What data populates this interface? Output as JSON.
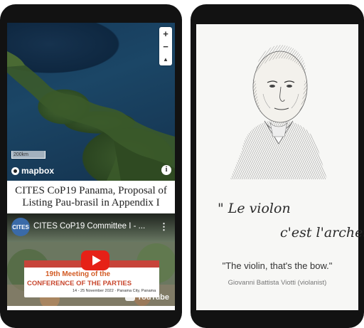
{
  "left_card": {
    "map": {
      "zoom_in_label": "+",
      "zoom_out_label": "−",
      "compass_label": "▲",
      "scale_label": "200km",
      "brand_label": "mapbox",
      "info_label": "i"
    },
    "title_line1": "CITES CoP19 Panama, Proposal of",
    "title_line2": "Listing Pau-brasil in Appendix I",
    "video": {
      "channel_badge": "CITES",
      "title": "CITES CoP19 Committee I - ...",
      "menu_label": "⋮",
      "banner_line1": "19th Meeting of the",
      "banner_line2": "CONFERENCE OF THE PARTIES",
      "banner_line3": "14 - 25 November 2022 · Panama City, Panama",
      "platform_label": "YouTube"
    }
  },
  "right_card": {
    "quote_french_line1": "\" Le violon",
    "quote_french_line2": "c'est l'archet\"",
    "quote_english": "\"The violin, that's the bow.\"",
    "attribution": "Giovanni Battista Viotti (violanist)"
  },
  "colors": {
    "phone_frame": "#121212",
    "youtube_red": "#e62117",
    "banner_red": "#c7443a"
  }
}
